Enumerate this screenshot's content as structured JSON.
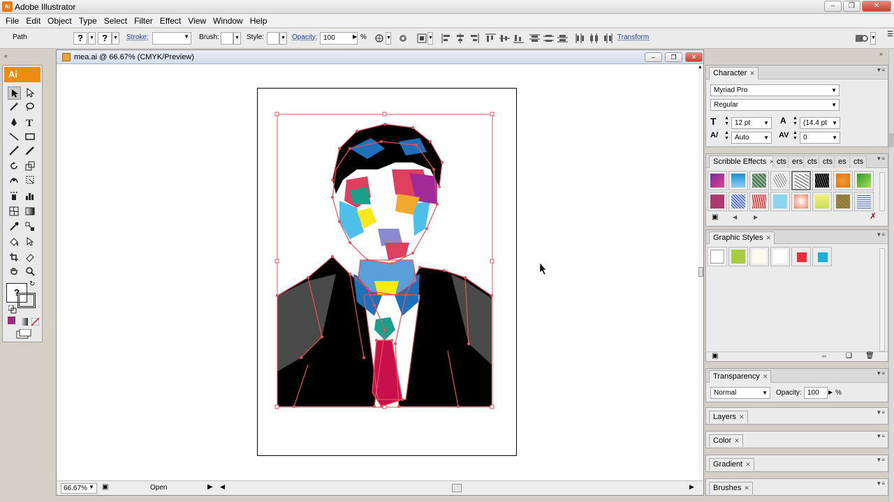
{
  "window": {
    "title": "Adobe Illustrator",
    "app_badge": "Ai"
  },
  "menu": [
    "File",
    "Edit",
    "Object",
    "Type",
    "Select",
    "Filter",
    "Effect",
    "View",
    "Window",
    "Help"
  ],
  "control_bar": {
    "selection_type": "Path",
    "fill_value": "?",
    "stroke_color_value": "?",
    "stroke_label": "Stroke:",
    "brush_label": "Brush:",
    "style_label": "Style:",
    "opacity_label": "Opacity:",
    "opacity_value": "100",
    "opacity_unit": "%",
    "transform_label": "Transform"
  },
  "tools": {
    "badge": "Ai",
    "fill_stroke_value": "?"
  },
  "document": {
    "tab_title": "mea.ai @ 66.67% (CMYK/Preview)",
    "zoom": "66.67%",
    "status": "Open"
  },
  "panels": {
    "character": {
      "tab": "Character",
      "font_family": "Myriad Pro",
      "font_style": "Regular",
      "font_size": "12 pt",
      "leading": "(14.4 pt",
      "kerning": "Auto",
      "tracking": "0"
    },
    "scribble": {
      "tabs": [
        "Scribble Effects",
        "cts",
        "ers",
        "cts",
        "cts",
        "es",
        "cts"
      ]
    },
    "graphic_styles": {
      "tab": "Graphic Styles"
    },
    "transparency": {
      "tab": "Transparency",
      "blend_mode": "Normal",
      "opacity_label": "Opacity:",
      "opacity_value": "100",
      "opacity_unit": "%"
    },
    "collapsed": [
      "Layers",
      "Color",
      "Gradient",
      "Brushes"
    ]
  },
  "colors": {
    "path_highlight": "#e8505b",
    "tie": "#c8104c",
    "shirt_blue": "#1e70b8",
    "ui_orange": "#f08a10"
  }
}
